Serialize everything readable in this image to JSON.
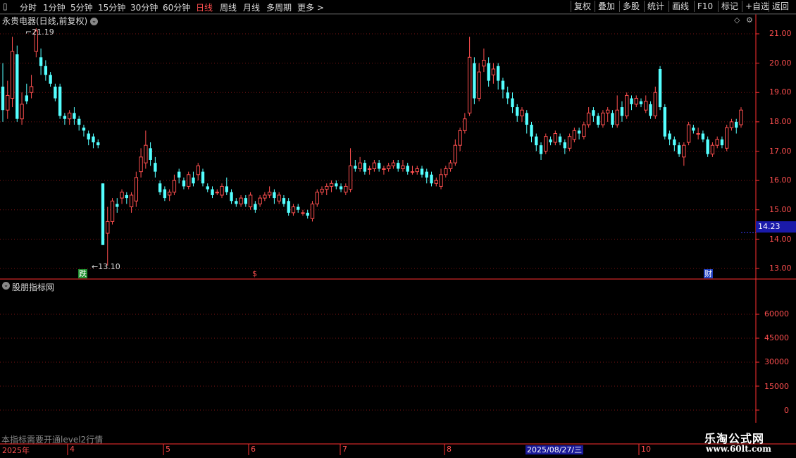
{
  "toolbar": {
    "periods": [
      "分时",
      "1分钟",
      "5分钟",
      "15分钟",
      "30分钟",
      "60分钟",
      "日线",
      "周线",
      "月线",
      "多周期",
      "更多"
    ],
    "active_period": "日线",
    "right_buttons": [
      "复权",
      "叠加",
      "多股",
      "统计",
      "画线",
      "F10",
      "标记",
      "+自选",
      "返回"
    ]
  },
  "stock": {
    "title": "永贵电器(日线,前复权)"
  },
  "panel": {
    "title": "股朋指标网",
    "note": "本指标需要开通level2行情"
  },
  "price_axis": {
    "labels": [
      "21.00",
      "20.00",
      "19.00",
      "18.00",
      "17.00",
      "16.00",
      "15.00",
      "14.00",
      "13.00"
    ]
  },
  "volume_axis": {
    "labels": [
      "60000",
      "45000",
      "30000",
      "15000",
      "0"
    ]
  },
  "current_price": "14.23",
  "annotations": {
    "high": "21.19",
    "low": "13.10"
  },
  "markers": {
    "drop": "跌",
    "dollar": "$",
    "finance": "财"
  },
  "date_axis": {
    "year": "2025年",
    "months": [
      "4",
      "5",
      "6",
      "7",
      "8",
      "10"
    ],
    "cursor_date": "2025/08/27/三"
  },
  "watermark": {
    "line1": "乐淘公式网",
    "line2": "www.60lt.com"
  },
  "colors": {
    "up": "#ff4f4f",
    "down": "#54ffff",
    "grid": "#7a1414",
    "axis": "#ff3030"
  },
  "chart_data": {
    "type": "candlestick",
    "title": "永贵电器(日线,前复权)",
    "ylim": [
      12.8,
      21.4
    ],
    "candles": [
      [
        19.2,
        18.4,
        20.0,
        18.0
      ],
      [
        18.4,
        18.9,
        19.4,
        18.1
      ],
      [
        18.8,
        20.4,
        20.9,
        18.5
      ],
      [
        20.3,
        18.1,
        20.6,
        18.0
      ],
      [
        18.1,
        18.6,
        19.0,
        17.9
      ],
      [
        18.9,
        18.7,
        19.3,
        18.6
      ],
      [
        19.0,
        19.2,
        19.6,
        18.8
      ],
      [
        20.4,
        21.1,
        21.19,
        20.2
      ],
      [
        20.2,
        19.9,
        20.5,
        19.6
      ],
      [
        19.9,
        19.6,
        20.1,
        19.4
      ],
      [
        19.6,
        19.3,
        19.7,
        19.2
      ],
      [
        19.2,
        18.8,
        19.3,
        18.7
      ],
      [
        19.2,
        18.2,
        19.3,
        18.1
      ],
      [
        18.2,
        18.1,
        18.3,
        17.9
      ],
      [
        18.1,
        18.3,
        18.4,
        17.9
      ],
      [
        18.3,
        18.1,
        18.5,
        17.9
      ],
      [
        18.1,
        17.9,
        18.2,
        17.7
      ],
      [
        17.8,
        17.7,
        17.9,
        17.5
      ],
      [
        17.6,
        17.4,
        17.7,
        17.2
      ],
      [
        17.5,
        17.3,
        17.6,
        17.1
      ],
      [
        17.3,
        17.2,
        17.4,
        17.1
      ],
      [
        15.9,
        13.8,
        15.9,
        13.8
      ],
      [
        14.2,
        14.6,
        15.1,
        13.1
      ],
      [
        14.6,
        15.3,
        15.4,
        14.5
      ],
      [
        15.2,
        15.1,
        15.4,
        14.9
      ],
      [
        15.4,
        15.6,
        15.7,
        15.2
      ],
      [
        15.5,
        15.4,
        15.6,
        15.2
      ],
      [
        15.1,
        15.5,
        15.6,
        14.9
      ],
      [
        15.3,
        16.1,
        16.3,
        15.1
      ],
      [
        16.3,
        16.8,
        17.1,
        16.1
      ],
      [
        16.6,
        17.2,
        17.7,
        16.4
      ],
      [
        17.1,
        16.7,
        17.3,
        16.5
      ],
      [
        16.6,
        16.3,
        16.8,
        16.1
      ],
      [
        15.9,
        15.6,
        16.0,
        15.5
      ],
      [
        15.7,
        15.4,
        15.8,
        15.3
      ],
      [
        15.5,
        15.6,
        15.7,
        15.3
      ],
      [
        15.6,
        16.0,
        16.2,
        15.5
      ],
      [
        16.3,
        16.1,
        16.4,
        15.9
      ],
      [
        16.0,
        15.8,
        16.1,
        15.7
      ],
      [
        15.8,
        16.2,
        16.3,
        15.7
      ],
      [
        16.1,
        15.9,
        16.3,
        15.8
      ],
      [
        16.2,
        16.5,
        16.6,
        16.0
      ],
      [
        16.3,
        15.9,
        16.4,
        15.8
      ],
      [
        15.8,
        15.7,
        15.9,
        15.6
      ],
      [
        15.7,
        15.5,
        15.8,
        15.4
      ],
      [
        15.6,
        15.6,
        15.7,
        15.5
      ],
      [
        15.5,
        15.8,
        15.9,
        15.4
      ],
      [
        15.8,
        15.6,
        16.1,
        15.5
      ],
      [
        15.6,
        15.3,
        15.7,
        15.2
      ],
      [
        15.3,
        15.2,
        15.4,
        15.1
      ],
      [
        15.2,
        15.4,
        15.5,
        15.1
      ],
      [
        15.4,
        15.2,
        15.5,
        15.1
      ],
      [
        15.1,
        15.5,
        15.6,
        15.0
      ],
      [
        15.2,
        15.0,
        15.3,
        14.9
      ],
      [
        15.2,
        15.4,
        15.5,
        15.1
      ],
      [
        15.4,
        15.5,
        15.6,
        15.3
      ],
      [
        15.5,
        15.6,
        15.8,
        15.4
      ],
      [
        15.6,
        15.4,
        15.7,
        15.2
      ],
      [
        15.3,
        15.5,
        15.6,
        15.2
      ],
      [
        15.4,
        15.2,
        15.5,
        15.1
      ],
      [
        15.3,
        14.9,
        15.4,
        14.8
      ],
      [
        14.9,
        15.1,
        15.2,
        14.8
      ],
      [
        15.1,
        15.0,
        15.2,
        14.9
      ],
      [
        14.9,
        14.9,
        15.0,
        14.8
      ],
      [
        14.9,
        14.8,
        15.0,
        14.7
      ],
      [
        14.7,
        15.2,
        15.3,
        14.6
      ],
      [
        15.2,
        15.6,
        15.7,
        15.1
      ],
      [
        15.6,
        15.7,
        15.8,
        15.5
      ],
      [
        15.7,
        15.8,
        15.9,
        15.5
      ],
      [
        15.8,
        15.9,
        16.0,
        15.6
      ],
      [
        15.9,
        15.8,
        16.0,
        15.7
      ],
      [
        15.8,
        15.7,
        15.9,
        15.6
      ],
      [
        15.6,
        15.8,
        15.9,
        15.5
      ],
      [
        15.7,
        16.5,
        17.1,
        15.6
      ],
      [
        16.5,
        16.4,
        16.7,
        16.3
      ],
      [
        16.4,
        16.6,
        16.8,
        16.3
      ],
      [
        16.6,
        16.3,
        16.7,
        16.2
      ],
      [
        16.4,
        16.4,
        16.5,
        16.2
      ],
      [
        16.4,
        16.6,
        16.7,
        16.3
      ],
      [
        16.6,
        16.4,
        16.7,
        16.3
      ],
      [
        16.4,
        16.4,
        16.5,
        16.2
      ],
      [
        16.4,
        16.5,
        16.6,
        16.3
      ],
      [
        16.5,
        16.6,
        16.7,
        16.4
      ],
      [
        16.6,
        16.4,
        16.7,
        16.3
      ],
      [
        16.4,
        16.5,
        16.7,
        16.3
      ],
      [
        16.5,
        16.3,
        16.6,
        16.2
      ],
      [
        16.3,
        16.3,
        16.5,
        16.2
      ],
      [
        16.3,
        16.4,
        16.5,
        16.2
      ],
      [
        16.4,
        16.2,
        16.5,
        16.1
      ],
      [
        16.3,
        16.1,
        16.4,
        15.9
      ],
      [
        16.2,
        15.9,
        16.3,
        15.8
      ],
      [
        15.9,
        16.0,
        16.1,
        15.8
      ],
      [
        15.8,
        16.2,
        16.4,
        15.7
      ],
      [
        16.2,
        16.4,
        16.5,
        16.1
      ],
      [
        16.4,
        16.6,
        16.7,
        16.3
      ],
      [
        16.6,
        17.2,
        17.4,
        16.5
      ],
      [
        17.2,
        17.7,
        17.8,
        17.0
      ],
      [
        17.7,
        18.1,
        18.3,
        17.6
      ],
      [
        18.3,
        20.2,
        20.9,
        18.2
      ],
      [
        20.0,
        18.8,
        20.2,
        18.6
      ],
      [
        18.8,
        19.7,
        20.0,
        18.7
      ],
      [
        19.9,
        20.1,
        20.5,
        19.7
      ],
      [
        20.0,
        19.4,
        20.2,
        19.2
      ],
      [
        19.6,
        19.8,
        20.0,
        19.3
      ],
      [
        19.9,
        19.4,
        20.0,
        19.1
      ],
      [
        19.4,
        19.1,
        19.5,
        18.8
      ],
      [
        19.0,
        18.8,
        19.2,
        18.6
      ],
      [
        18.8,
        18.5,
        19.0,
        18.3
      ],
      [
        18.5,
        18.2,
        18.6,
        18.0
      ],
      [
        18.2,
        18.4,
        18.5,
        18.0
      ],
      [
        18.3,
        17.9,
        18.4,
        17.6
      ],
      [
        17.9,
        17.5,
        18.0,
        17.3
      ],
      [
        17.5,
        17.2,
        17.6,
        17.0
      ],
      [
        17.2,
        16.9,
        17.3,
        16.7
      ],
      [
        17.0,
        17.5,
        17.6,
        16.9
      ],
      [
        17.4,
        17.3,
        17.5,
        17.2
      ],
      [
        17.3,
        17.6,
        17.7,
        17.2
      ],
      [
        17.5,
        17.3,
        17.6,
        17.2
      ],
      [
        17.3,
        17.1,
        17.4,
        16.9
      ],
      [
        17.1,
        17.5,
        17.6,
        17.0
      ],
      [
        17.4,
        17.7,
        17.8,
        17.3
      ],
      [
        17.7,
        17.6,
        17.8,
        17.4
      ],
      [
        17.5,
        17.9,
        18.0,
        17.4
      ],
      [
        17.9,
        18.3,
        18.5,
        17.8
      ],
      [
        18.4,
        18.2,
        18.5,
        18.0
      ],
      [
        18.2,
        17.9,
        18.3,
        17.8
      ],
      [
        17.9,
        18.3,
        18.4,
        17.8
      ],
      [
        18.3,
        18.4,
        18.5,
        18.0
      ],
      [
        18.3,
        17.9,
        18.4,
        17.8
      ],
      [
        17.9,
        18.4,
        18.9,
        17.8
      ],
      [
        18.5,
        18.2,
        18.7,
        18.0
      ],
      [
        18.2,
        18.9,
        19.0,
        18.1
      ],
      [
        18.8,
        18.6,
        18.9,
        18.4
      ],
      [
        18.6,
        18.8,
        18.9,
        18.5
      ],
      [
        18.7,
        18.6,
        18.8,
        18.5
      ],
      [
        18.4,
        18.7,
        18.9,
        18.3
      ],
      [
        18.6,
        18.2,
        18.7,
        18.1
      ],
      [
        18.2,
        19.0,
        19.2,
        18.1
      ],
      [
        19.8,
        18.5,
        19.9,
        18.4
      ],
      [
        18.5,
        17.5,
        18.6,
        17.4
      ],
      [
        17.6,
        17.4,
        17.7,
        17.2
      ],
      [
        17.4,
        17.2,
        17.5,
        17.0
      ],
      [
        17.2,
        16.9,
        17.3,
        16.8
      ],
      [
        16.8,
        17.2,
        17.3,
        16.5
      ],
      [
        17.3,
        17.9,
        18.0,
        17.2
      ],
      [
        17.8,
        17.7,
        17.9,
        17.6
      ],
      [
        17.6,
        17.6,
        17.8,
        17.4
      ],
      [
        17.6,
        17.4,
        17.7,
        17.3
      ],
      [
        17.4,
        16.9,
        17.5,
        16.8
      ],
      [
        16.9,
        17.2,
        17.3,
        16.8
      ],
      [
        17.2,
        17.4,
        17.5,
        17.1
      ],
      [
        17.4,
        17.2,
        17.5,
        17.1
      ],
      [
        17.1,
        17.8,
        17.9,
        17.0
      ],
      [
        17.8,
        18.0,
        18.1,
        17.7
      ],
      [
        18.0,
        17.8,
        18.1,
        17.6
      ],
      [
        17.9,
        18.4,
        18.5,
        17.8
      ]
    ],
    "current_price": 14.23,
    "high_marker": 21.19,
    "low_marker": 13.1,
    "volume_ylim": [
      0,
      70000
    ]
  }
}
